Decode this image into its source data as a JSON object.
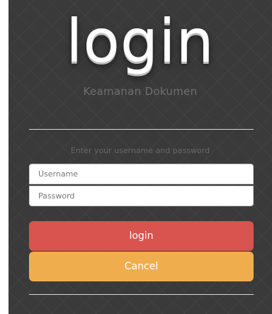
{
  "header": {
    "logo_text": "login",
    "subtitle": "Keamanan Dokumen"
  },
  "form": {
    "prompt": "Enter your username and password",
    "username": {
      "placeholder": "Username",
      "value": ""
    },
    "password": {
      "placeholder": "Password",
      "value": ""
    },
    "login_label": "login",
    "cancel_label": "Cancel"
  },
  "colors": {
    "background": "#3a3a3a",
    "login_button": "#d9534f",
    "cancel_button": "#f0ad4e"
  }
}
